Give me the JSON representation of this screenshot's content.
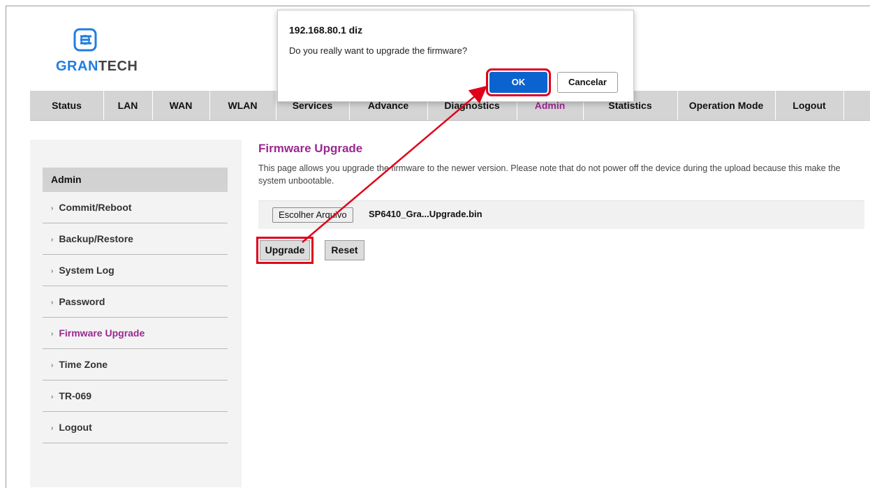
{
  "logo": {
    "brand_accent": "GRAN",
    "brand_rest": "TECH"
  },
  "topnav": {
    "tabs": [
      {
        "label": "Status"
      },
      {
        "label": "LAN"
      },
      {
        "label": "WAN"
      },
      {
        "label": "WLAN"
      },
      {
        "label": "Services"
      },
      {
        "label": "Advance"
      },
      {
        "label": "Diagnostics"
      },
      {
        "label": "Admin"
      },
      {
        "label": "Statistics"
      },
      {
        "label": "Operation Mode"
      },
      {
        "label": "Logout"
      }
    ]
  },
  "sidebar": {
    "heading": "Admin",
    "items": [
      {
        "label": "Commit/Reboot"
      },
      {
        "label": "Backup/Restore"
      },
      {
        "label": "System Log"
      },
      {
        "label": "Password"
      },
      {
        "label": "Firmware Upgrade"
      },
      {
        "label": "Time Zone"
      },
      {
        "label": "TR-069"
      },
      {
        "label": "Logout"
      }
    ]
  },
  "main": {
    "title": "Firmware Upgrade",
    "description": "This page allows you upgrade the firmware to the newer version. Please note that do not power off the device during the upload because this make the system unbootable.",
    "file_button": "Escolher Arquivo",
    "file_name": "SP6410_Gra...Upgrade.bin",
    "upgrade_button": "Upgrade",
    "reset_button": "Reset"
  },
  "dialog": {
    "title": "192.168.80.1 diz",
    "message": "Do you really want to upgrade the firmware?",
    "ok": "OK",
    "cancel": "Cancelar"
  },
  "colors": {
    "accent_purple": "#9a2890",
    "dialog_ok_blue": "#0b63cf",
    "highlight_red": "#e0001a",
    "brand_blue": "#1f7de0"
  }
}
